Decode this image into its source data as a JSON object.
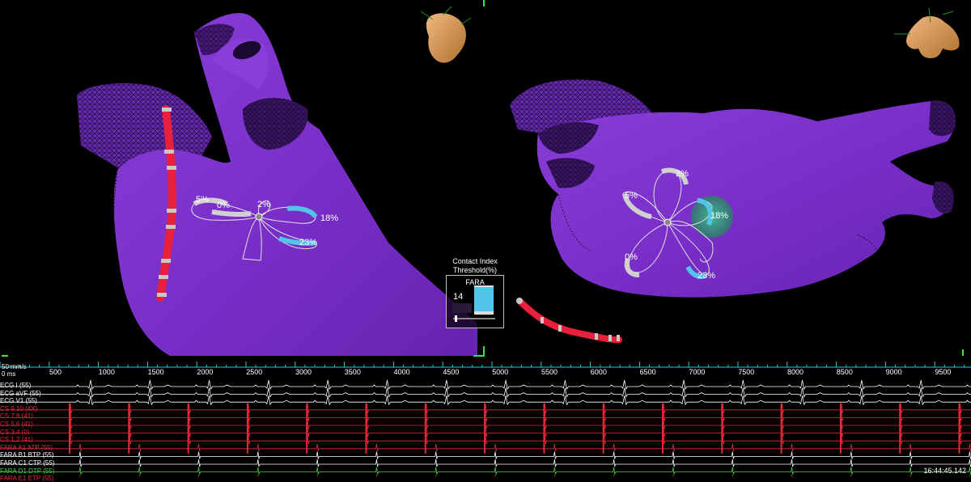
{
  "left_view": {
    "ablation_labels": [
      "5%",
      "0%",
      "2%",
      "18%",
      "23%"
    ]
  },
  "right_view": {
    "ablation_labels": [
      "2%",
      "5%",
      "18%",
      "0%",
      "23%"
    ]
  },
  "contact_index": {
    "title_line1": "Contact Index",
    "title_line2": "Threshold(%)",
    "catheter": "FARA",
    "value": "14",
    "bar_color": "#52c4e8"
  },
  "ecg": {
    "speed": "50 mm/s",
    "ms_label": "0 ms",
    "ticks": [
      "500",
      "1000",
      "1500",
      "2000",
      "2500",
      "3000",
      "3500",
      "4000",
      "4500",
      "5000",
      "5500",
      "6000",
      "6500",
      "7000",
      "7500",
      "8000",
      "8500",
      "9000",
      "9500"
    ],
    "channels": [
      {
        "label": "ECG I (55)",
        "color": "#ffffff"
      },
      {
        "label": "ECG aVF (55)",
        "color": "#ffffff"
      },
      {
        "label": "ECG V1 (55)",
        "color": "#ffffff"
      },
      {
        "label": "CS 9,10 (4X)",
        "color": "#e8283c"
      },
      {
        "label": "CS 7,8 (41)",
        "color": "#e8283c"
      },
      {
        "label": "CS 5,6 (41)",
        "color": "#e8283c"
      },
      {
        "label": "CS 3,4 (0)",
        "color": "#e8283c"
      },
      {
        "label": "CS 1,2 (41)",
        "color": "#e8283c"
      },
      {
        "label": "FARA A1 ATP (55)",
        "color": "#e8283c"
      },
      {
        "label": "FARA B1 BTP (55)",
        "color": "#ffffff"
      },
      {
        "label": "FARA C1 CTP (55)",
        "color": "#ffffff"
      },
      {
        "label": "FARA D1 DTP (55)",
        "color": "#40d040"
      },
      {
        "label": "FARA E1 ETP (55)",
        "color": "#e8283c"
      }
    ],
    "timestamp": "16:44:45.142",
    "accent_color": "#33c6d6",
    "atrial_color": "#e8283c"
  }
}
